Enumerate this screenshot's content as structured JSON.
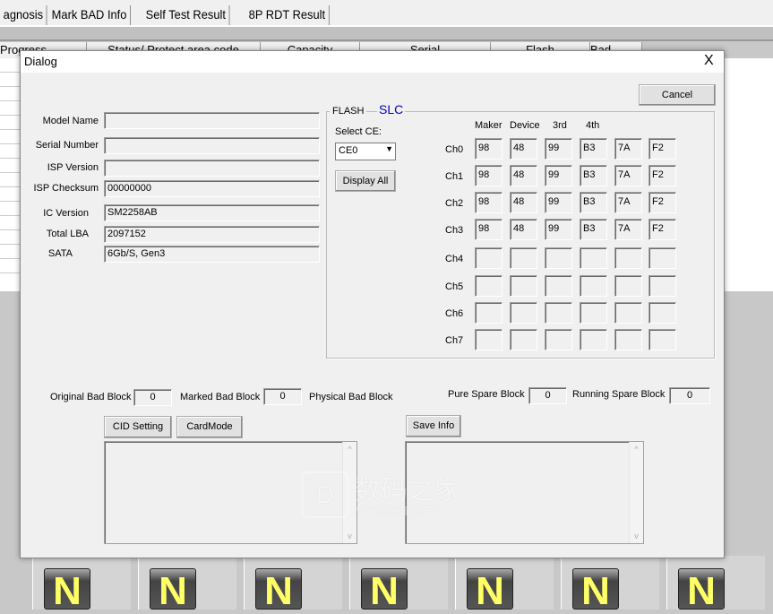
{
  "tabs": [
    "agnosis",
    "Mark BAD Info",
    "Self Test Result",
    "8P RDT Result"
  ],
  "columns": [
    "Progress",
    "Status/ Protect area code",
    "Capacity",
    "Serial",
    "Flash",
    "Bad"
  ],
  "tiles": [
    "N",
    "N",
    "N",
    "N",
    "N",
    "N",
    "N"
  ],
  "watermark": {
    "cn": "数码之家",
    "en": "MYDIGIT.NET"
  },
  "dialog": {
    "title": "Dialog",
    "close": "X",
    "cancel": "Cancel",
    "info": [
      {
        "label": "Model Name",
        "value": ""
      },
      {
        "label": "Serial Number",
        "value": ""
      },
      {
        "label": "ISP Version",
        "value": ""
      },
      {
        "label": "ISP Checksum",
        "value": "00000000"
      },
      {
        "label": "IC Version",
        "value": "SM2258AB"
      },
      {
        "label": "Total LBA",
        "value": "2097152"
      },
      {
        "label": "SATA",
        "value": "6Gb/S, Gen3"
      }
    ],
    "flash": {
      "label": "FLASH",
      "mode": "SLC",
      "select_ce_label": "Select CE:",
      "select_ce_value": "CE0",
      "display_all": "Display All",
      "headers": [
        "Maker",
        "Device",
        "3rd",
        "4th"
      ],
      "rows": [
        {
          "ch": "Ch0",
          "ids": [
            "98",
            "48",
            "99",
            "B3",
            "7A",
            "F2"
          ]
        },
        {
          "ch": "Ch1",
          "ids": [
            "98",
            "48",
            "99",
            "B3",
            "7A",
            "F2"
          ]
        },
        {
          "ch": "Ch2",
          "ids": [
            "98",
            "48",
            "99",
            "B3",
            "7A",
            "F2"
          ]
        },
        {
          "ch": "Ch3",
          "ids": [
            "98",
            "48",
            "99",
            "B3",
            "7A",
            "F2"
          ]
        },
        {
          "ch": "Ch4",
          "ids": [
            "",
            "",
            "",
            "",
            "",
            ""
          ]
        },
        {
          "ch": "Ch5",
          "ids": [
            "",
            "",
            "",
            "",
            "",
            ""
          ]
        },
        {
          "ch": "Ch6",
          "ids": [
            "",
            "",
            "",
            "",
            "",
            ""
          ]
        },
        {
          "ch": "Ch7",
          "ids": [
            "",
            "",
            "",
            "",
            "",
            ""
          ]
        }
      ]
    },
    "bad": {
      "original_label": "Original Bad Block",
      "original": "0",
      "marked_label": "Marked Bad Block",
      "marked": "0",
      "physical_label": "Physical Bad Block",
      "pure_label": "Pure Spare Block",
      "pure": "0",
      "running_label": "Running Spare Block",
      "running": "0"
    },
    "cid_setting": "CID Setting",
    "card_mode": "CardMode",
    "save_info": "Save Info"
  }
}
